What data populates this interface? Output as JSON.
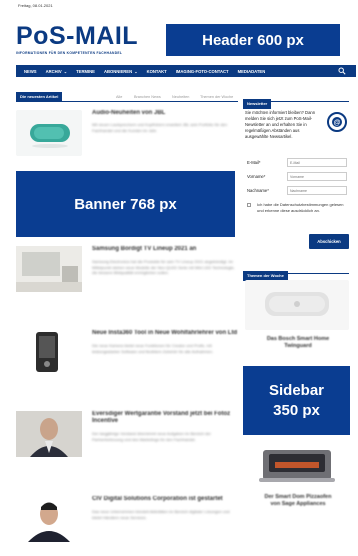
{
  "topbar": {
    "date": "Freitag, 08.01.2021"
  },
  "logo": {
    "name": "PoS-MAIL",
    "tagline": "INFORMATIONEN FÜR DEN KOMPETENTEN FACHHANDEL"
  },
  "header_ad": {
    "label": "Header 600 px"
  },
  "nav": {
    "items": [
      {
        "label": "NEWS"
      },
      {
        "label": "ARCHIV",
        "dropdown": true
      },
      {
        "label": "TERMINE"
      },
      {
        "label": "ABONNIEREN",
        "dropdown": true
      },
      {
        "label": "KONTAKT"
      },
      {
        "label": "IMAGING-FOTO-CONTACT"
      },
      {
        "label": "MEDIADATEN"
      }
    ],
    "search_icon": "search-icon"
  },
  "tabs": {
    "active": "Die neuesten Artikel",
    "others": [
      "Alle",
      "Branchen News",
      "Neuheiten",
      "Themen der Woche"
    ]
  },
  "articles": [
    {
      "title": "Audio-Neuheiten von JBL",
      "excerpt": "Mit neuen Lautsprechern und Kopfhörern erweitert JBL sein Portfolio für den Fachhandel und die Kunden im Jahr."
    },
    {
      "title": "Samsung Bordigt TV Lineup 2021 an",
      "excerpt": "Samsung Electronics hat die Produkte für sein TV Lineup 2021 angekündigt. Im Mittelpunkt stehen neue Modelle der Neo QLED Serie mit Mini LED Technologie, die bessere Bildqualität ermöglichen sollen."
    },
    {
      "title": "Neue Insta360 Tool in Neue Wohlfahrlehrer von Ltd",
      "excerpt": "Die neue Kamera bietet neue Funktionen für Creator und Profis, mit leistungsstarker Software und flexiblem Zubehör für alle Aufnahmen."
    },
    {
      "title": "Eversdiger Wertgarantie Vorstand jetzt bei Fotoz Incentive",
      "excerpt": "Der langjährige Vorstand übernimmt neue Aufgaben im Bereich der Partnerbetreuung und des Marketings für den Fachhandel."
    },
    {
      "title": "CIV Digital Solutions Corporation ist gestartet",
      "excerpt": "Das neue Unternehmen bündelt Aktivitäten im Bereich digitaler Lösungen und bietet Händlern neue Services."
    }
  ],
  "banner": {
    "label": "Banner 768 px"
  },
  "newsletter": {
    "heading": "Newsletter",
    "intro": "Sie möchten informiert bleiben? Dann melden Sie sich jetzt zum PoS-Mail-Newsletter an und erhalten Sie in regelmäßigen Abständen aus ausgewählte Newsartikel.",
    "fields": [
      {
        "label": "E-Mail*",
        "placeholder": "E-Mail"
      },
      {
        "label": "Vorname*",
        "placeholder": "Vorname"
      },
      {
        "label": "Nachname*",
        "placeholder": "Nachname"
      }
    ],
    "consent": "Ich habe die Datenschutzbestimmungen gelesen und erkenne diese ausdrücklich an.",
    "submit": "Abschicken",
    "icon": "mail-icon"
  },
  "themen": {
    "heading": "Themen der Woche",
    "items": [
      {
        "title": "Das Bosch Smart Home Twinguard"
      },
      {
        "title": "Der Smart Dom Pizzaofen von Sage Appliances"
      }
    ]
  },
  "sidebar_ad": {
    "line1": "Sidebar",
    "line2": "350 px"
  },
  "colors": {
    "brand": "#0b3a82",
    "ad": "#0a3d91"
  }
}
